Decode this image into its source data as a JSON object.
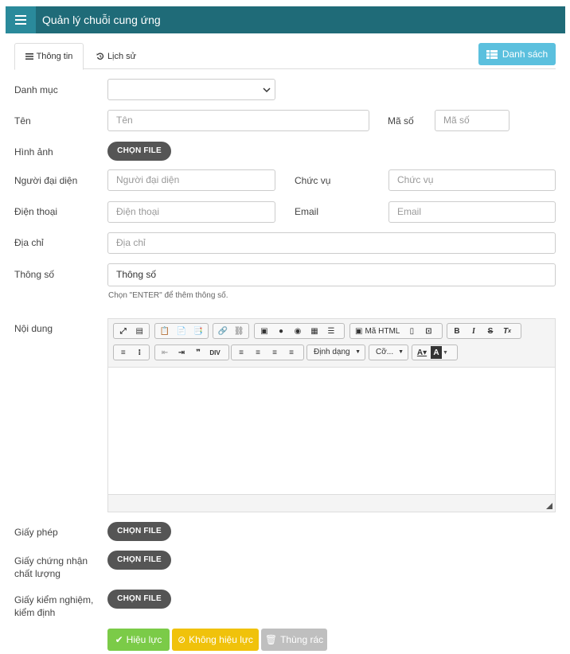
{
  "header": {
    "title": "Quản lý chuỗi cung ứng",
    "menu_icon": "hamburger-icon"
  },
  "tabs": {
    "info": "Thông tin",
    "history": "Lịch sử"
  },
  "list_button": "Danh sách",
  "form": {
    "category_label": "Danh mục",
    "category_value": "",
    "name_label": "Tên",
    "name_placeholder": "Tên",
    "code_label": "Mã số",
    "code_placeholder": "Mã số",
    "image_label": "Hình ảnh",
    "representative_label": "Người đại diện",
    "representative_placeholder": "Người đại diện",
    "position_label": "Chức vụ",
    "position_placeholder": "Chức vụ",
    "phone_label": "Điện thoại",
    "phone_placeholder": "Điện thoại",
    "email_label": "Email",
    "email_placeholder": "Email",
    "address_label": "Địa chỉ",
    "address_placeholder": "Địa chỉ",
    "specs_label": "Thông số",
    "specs_value": "Thông số",
    "specs_hint": "Chọn \"ENTER\" để thêm thông số.",
    "content_label": "Nội dung",
    "license_label": "Giấy phép",
    "quality_label_1": "Giấy chứng nhận",
    "quality_label_2": "chất lượng",
    "inspection_label_1": "Giấy kiểm nghiệm,",
    "inspection_label_2": "kiểm định",
    "choose_file": "CHỌN FILE"
  },
  "editor": {
    "source_label": "Mã HTML",
    "format_label": "Định dạng",
    "size_label": "Cỡ..."
  },
  "actions": {
    "active": "Hiệu lực",
    "inactive": "Không hiệu lực",
    "trash": "Thùng rác"
  },
  "colors": {
    "header": "#1f6b78",
    "info": "#5bc0de",
    "success": "#7bcb48",
    "warning": "#f0c20b",
    "muted": "#bfbfbf"
  }
}
